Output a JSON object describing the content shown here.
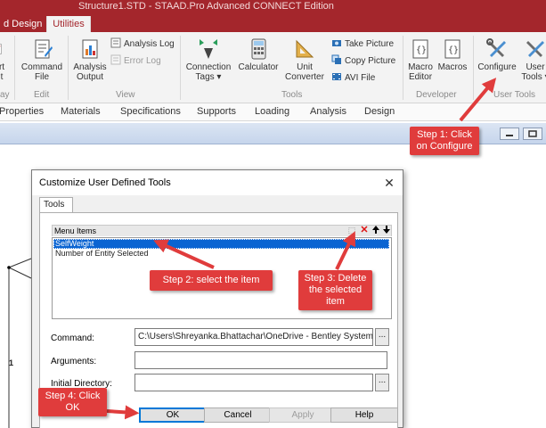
{
  "window": {
    "title": "Structure1.STD - STAAD.Pro Advanced CONNECT Edition"
  },
  "ribbon_tabs": [
    {
      "label": "d Design"
    },
    {
      "label": "Utilities"
    }
  ],
  "ribbon": {
    "report_fragment": {
      "line1": "rt",
      "line2": "t"
    },
    "command_file": {
      "line1": "Command",
      "line2": "File"
    },
    "analysis_output": {
      "line1": "Analysis",
      "line2": "Output"
    },
    "analysis_log": "Analysis Log",
    "error_log": "Error Log",
    "connection_tags": {
      "line1": "Connection",
      "line2": "Tags ▾"
    },
    "calculator": "Calculator",
    "unit_converter": {
      "line1": "Unit",
      "line2": "Converter"
    },
    "take_picture": "Take Picture",
    "copy_picture": "Copy Picture",
    "avi_file": "AVI File",
    "macro_editor": {
      "line1": "Macro",
      "line2": "Editor"
    },
    "macros": "Macros",
    "configure": "Configure",
    "user_tools": {
      "line1": "User",
      "line2": "Tools ▾"
    },
    "groups": {
      "display_fragment": "ay",
      "edit": "Edit",
      "view": "View",
      "tools": "Tools",
      "developer": "Developer",
      "user_tools": "User Tools"
    }
  },
  "page_tabs": [
    "Properties",
    "Materials",
    "Specifications",
    "Supports",
    "Loading",
    "Analysis",
    "Design"
  ],
  "workspace": {
    "node_label": "1"
  },
  "dialog": {
    "title": "Customize User Defined Tools",
    "close_glyph": "✕",
    "tab": "Tools",
    "list_header": "Menu Items",
    "list_icons": {
      "new": "⬚",
      "delete": "✕",
      "up": "🠕",
      "down": "🠗"
    },
    "menu_items": [
      "SelfWeight",
      "Number of Entity Selected"
    ],
    "command_label": "Command:",
    "command_value": "C:\\Users\\Shreyanka.Bhattachar\\OneDrive - Bentley Systems, Inc\\",
    "arguments_label": "Arguments:",
    "arguments_value": "",
    "initial_dir_label": "Initial Directory:",
    "initial_dir_value": "",
    "browse_label": "...",
    "buttons": {
      "ok": "OK",
      "cancel": "Cancel",
      "apply": "Apply",
      "help": "Help"
    }
  },
  "callouts": {
    "step1": "Step 1: Click on Configure",
    "step2": "Step 2: select the item",
    "step3": "Step 3: Delete the selected item",
    "step4": "Step 4: Click OK"
  },
  "colors": {
    "brand_red": "#a4262c",
    "callout_red": "#e03c3c",
    "selection_blue": "#0a64d2"
  }
}
